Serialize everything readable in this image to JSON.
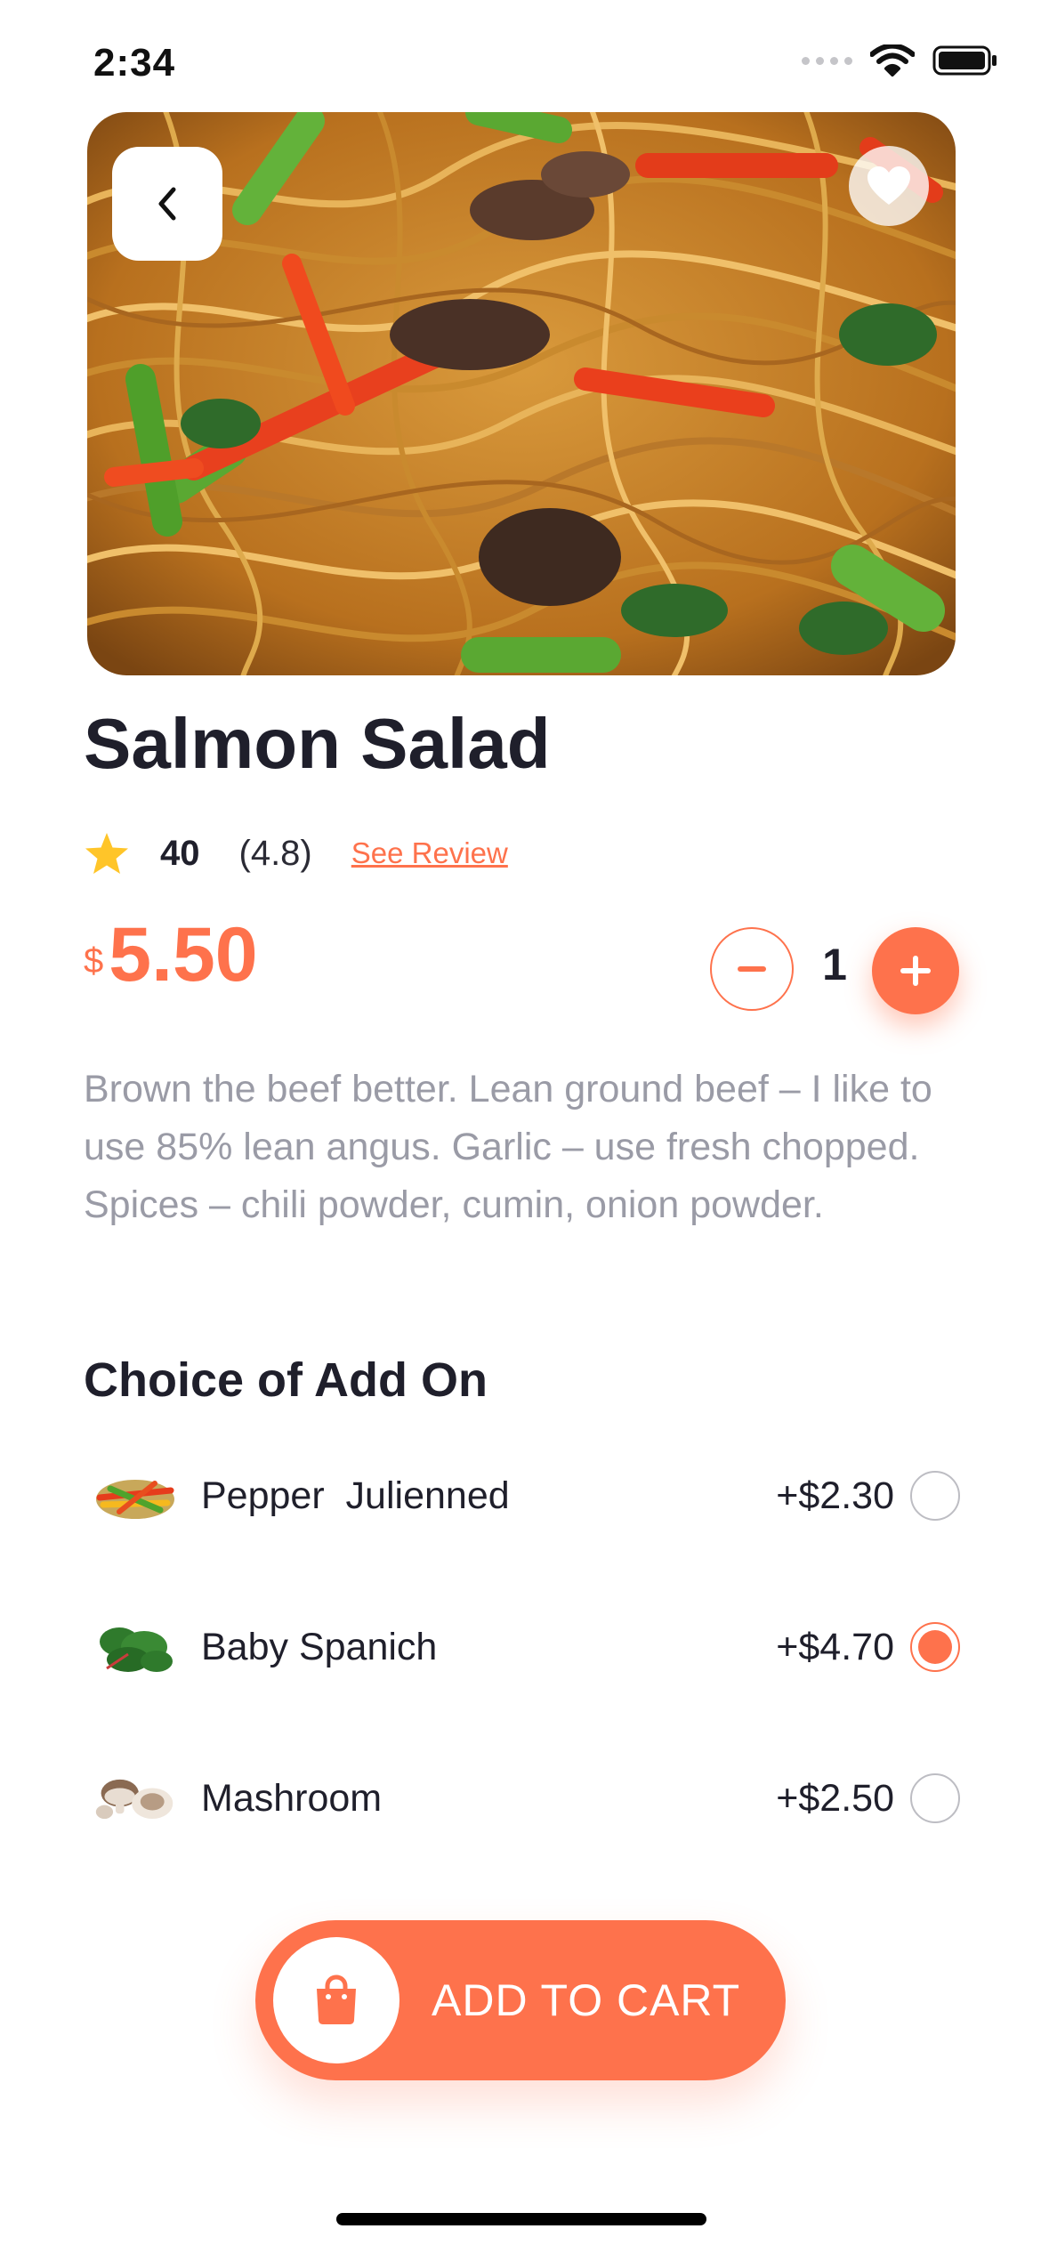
{
  "status_bar": {
    "time": "2:34"
  },
  "product": {
    "title": "Salmon Salad",
    "rating_count": "40",
    "rating_score": "(4.8)",
    "see_review": "See Review",
    "price_currency": "$",
    "price_amount": "5.50",
    "quantity": "1",
    "description": "Brown the beef better. Lean ground beef – I like to use 85% lean angus. Garlic – use fresh chopped. Spices – chili powder, cumin, onion powder."
  },
  "addons": {
    "title": "Choice of Add On",
    "items": [
      {
        "name": "Pepper  Julienned",
        "price": "+$2.30",
        "selected": false
      },
      {
        "name": "Baby Spanich",
        "price": "+$4.70",
        "selected": true
      },
      {
        "name": "Mashroom",
        "price": "+$2.50",
        "selected": false
      }
    ]
  },
  "cart_button": {
    "label": "ADD TO CART"
  },
  "colors": {
    "accent": "#fe724c",
    "text": "#1f1f2b",
    "muted": "#9a9ba6",
    "star": "#ffc529"
  },
  "icons": {
    "back": "chevron-left-icon",
    "favorite": "heart-icon",
    "star": "star-icon",
    "minus": "minus-icon",
    "plus": "plus-icon",
    "bag": "shopping-bag-icon"
  }
}
